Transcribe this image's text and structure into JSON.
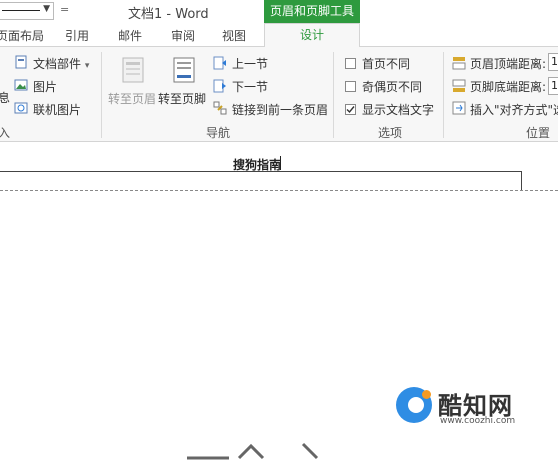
{
  "window": {
    "title": "文档1 - Word",
    "qat_separator": "="
  },
  "context_group": {
    "label": "页眉和页脚工具"
  },
  "tabs": [
    {
      "label": "页面布局"
    },
    {
      "label": "引用"
    },
    {
      "label": "邮件"
    },
    {
      "label": "审阅"
    },
    {
      "label": "视图"
    },
    {
      "label": "设计"
    }
  ],
  "ribbon": {
    "insert": {
      "info_partial": "息",
      "doc_parts": "文档部件",
      "doc_parts_arrow": "▾",
      "picture": "图片",
      "online_picture": "联机图片",
      "group_label_partial": "入"
    },
    "navigation": {
      "goto_header": "转至页眉",
      "goto_footer": "转至页脚",
      "previous": "上一节",
      "next": "下一节",
      "link_previous": "链接到前一条页眉",
      "group_label": "导航"
    },
    "options": {
      "different_first": "首页不同",
      "different_odd_even": "奇偶页不同",
      "show_doc_text": "显示文档文字",
      "group_label": "选项"
    },
    "position": {
      "header_top": "页眉顶端距离:",
      "footer_bottom": "页脚底端距离:",
      "insert_align": "插入\"对齐方式\"选",
      "spin1": "1",
      "spin2": "1",
      "group_label": "位置"
    }
  },
  "document": {
    "header_text": "搜狗指南"
  },
  "watermark": {
    "name": "酷知网",
    "url": "www.coozhi.com"
  },
  "colors": {
    "accent": "#2e9a3e",
    "watermark_blue": "#2f8de4",
    "watermark_orange": "#f59a23"
  }
}
